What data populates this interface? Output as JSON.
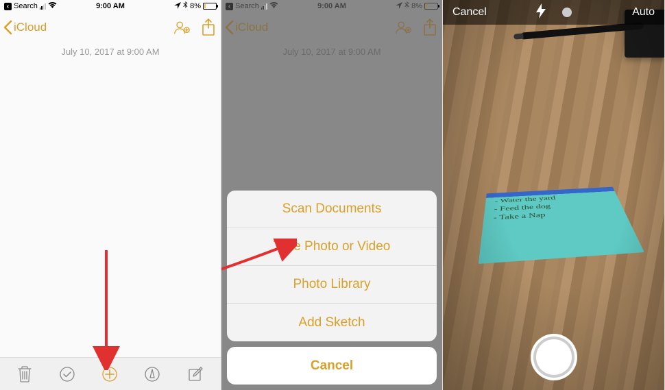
{
  "statusbar": {
    "search": "Search",
    "time": "9:00 AM",
    "battery_pct": "8%"
  },
  "nav": {
    "back_label": "iCloud"
  },
  "note": {
    "timestamp": "July 10, 2017 at 9:00 AM"
  },
  "sheet": {
    "scan": "Scan Documents",
    "photo": "Take Photo or Video",
    "library": "Photo Library",
    "sketch": "Add Sketch",
    "cancel": "Cancel"
  },
  "camera": {
    "cancel": "Cancel",
    "auto": "Auto",
    "note_lines": [
      "- Water the yard",
      "- Feed the dog",
      "- Take a Nap"
    ]
  }
}
